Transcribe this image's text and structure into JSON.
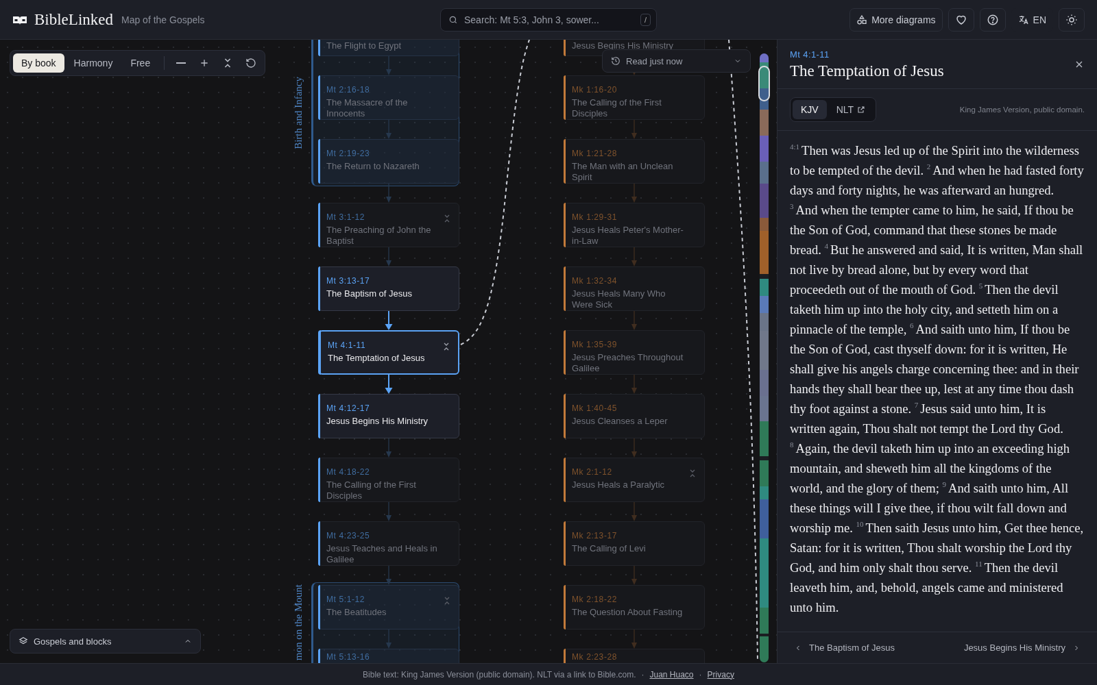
{
  "header": {
    "logo": "BibleLinked",
    "subtitle": "Map of the Gospels",
    "search": {
      "placeholder": "Search: Mt 5:3, John 3, sower...",
      "shortcut": "/"
    },
    "more_button": "More diagrams",
    "language": "EN"
  },
  "toolbar": {
    "modes": [
      {
        "label": "By book",
        "selected": true
      },
      {
        "label": "Harmony",
        "selected": false
      },
      {
        "label": "Free",
        "selected": false
      }
    ]
  },
  "history": {
    "label": "Read just now"
  },
  "legend": {
    "label": "Gospels and blocks"
  },
  "canvas": {
    "columns": [
      {
        "color": "#5ba3f5",
        "items": [
          {
            "kind": "group",
            "label": "Birth and Infancy",
            "nodes": [
              {
                "title": "The Flight to Egypt",
                "dimmed": true,
                "selected": false,
                "collapsible": false
              },
              {
                "ref": "Mt 2:16-18",
                "title": "The Massacre of the Innocents",
                "dimmed": true,
                "selected": false,
                "collapsible": false
              },
              {
                "ref": "Mt 2:19-23",
                "title": "The Return to Nazareth",
                "dimmed": true,
                "selected": false,
                "collapsible": false
              }
            ]
          },
          {
            "kind": "node",
            "ref": "Mt 3:1-12",
            "title": "The Preaching of John the Baptist",
            "dimmed": true,
            "selected": false,
            "collapsible": true
          },
          {
            "kind": "node",
            "ref": "Mt 3:13-17",
            "title": "The Baptism of Jesus",
            "dimmed": false,
            "selected": false,
            "collapsible": false
          },
          {
            "kind": "node",
            "ref": "Mt 4:1-11",
            "title": "The Temptation of Jesus",
            "dimmed": false,
            "selected": true,
            "collapsible": true
          },
          {
            "kind": "node",
            "ref": "Mt 4:12-17",
            "title": "Jesus Begins His Ministry",
            "dimmed": false,
            "selected": false,
            "collapsible": false
          },
          {
            "kind": "node",
            "ref": "Mt 4:18-22",
            "title": "The Calling of the First Disciples",
            "dimmed": true,
            "selected": false,
            "collapsible": false
          },
          {
            "kind": "node",
            "ref": "Mt 4:23-25",
            "title": "Jesus Teaches and Heals in Galilee",
            "dimmed": true,
            "selected": false,
            "collapsible": false
          },
          {
            "kind": "group",
            "label": "mon on the Mount",
            "nodes": [
              {
                "ref": "Mt 5:1-12",
                "title": "The Beatitudes",
                "dimmed": true,
                "selected": false,
                "collapsible": true
              },
              {
                "ref": "Mt 5:13-16",
                "dimmed": true,
                "selected": false,
                "collapsible": false
              }
            ]
          }
        ]
      },
      {
        "color": "#c27a3a",
        "items": [
          {
            "kind": "node",
            "title": "Jesus Begins His Ministry",
            "dimmed": true,
            "selected": false,
            "collapsible": false
          },
          {
            "kind": "node",
            "ref": "Mk 1:16-20",
            "title": "The Calling of the First Disciples",
            "dimmed": true,
            "selected": false,
            "collapsible": false
          },
          {
            "kind": "node",
            "ref": "Mk 1:21-28",
            "title": "The Man with an Unclean Spirit",
            "dimmed": true,
            "selected": false,
            "collapsible": false
          },
          {
            "kind": "node",
            "ref": "Mk 1:29-31",
            "title": "Jesus Heals Peter's Mother-in-Law",
            "dimmed": true,
            "selected": false,
            "collapsible": false
          },
          {
            "kind": "node",
            "ref": "Mk 1:32-34",
            "title": "Jesus Heals Many Who Were Sick",
            "dimmed": true,
            "selected": false,
            "collapsible": false
          },
          {
            "kind": "node",
            "ref": "Mk 1:35-39",
            "title": "Jesus Preaches Throughout Galilee",
            "dimmed": true,
            "selected": false,
            "collapsible": false
          },
          {
            "kind": "node",
            "ref": "Mk 1:40-45",
            "title": "Jesus Cleanses a Leper",
            "dimmed": true,
            "selected": false,
            "collapsible": false
          },
          {
            "kind": "node",
            "ref": "Mk 2:1-12",
            "title": "Jesus Heals a Paralytic",
            "dimmed": true,
            "selected": false,
            "collapsible": true
          },
          {
            "kind": "node",
            "ref": "Mk 2:13-17",
            "title": "The Calling of Levi",
            "dimmed": true,
            "selected": false,
            "collapsible": false
          },
          {
            "kind": "node",
            "ref": "Mk 2:18-22",
            "title": "The Question About Fasting",
            "dimmed": true,
            "selected": false,
            "collapsible": false
          },
          {
            "kind": "node",
            "ref": "Mk 2:23-28",
            "dimmed": true,
            "selected": false,
            "collapsible": false
          }
        ]
      }
    ]
  },
  "reader": {
    "ref": "Mt 4:1-11",
    "title": "The Temptation of Jesus",
    "versions": [
      {
        "label": "KJV",
        "selected": true,
        "external": false
      },
      {
        "label": "NLT",
        "selected": false,
        "external": true
      }
    ],
    "version_note": "King James Version, public domain.",
    "verses": [
      {
        "num": "4:1",
        "text": "Then was Jesus led up of the Spirit into the wilderness to be tempted of the devil."
      },
      {
        "num": "2",
        "text": "And when he had fasted forty days and forty nights, he was afterward an hungred."
      },
      {
        "num": "3",
        "text": "And when the tempter came to him, he said, If thou be the Son of God, command that these stones be made bread."
      },
      {
        "num": "4",
        "text": "But he answered and said, It is written, Man shall not live by bread alone, but by every word that proceedeth out of the mouth of God."
      },
      {
        "num": "5",
        "text": "Then the devil taketh him up into the holy city, and setteth him on a pinnacle of the temple,"
      },
      {
        "num": "6",
        "text": "And saith unto him, If thou be the Son of God, cast thyself down: for it is written, He shall give his angels charge concerning thee: and in their hands they shall bear thee up, lest at any time thou dash thy foot against a stone."
      },
      {
        "num": "7",
        "text": "Jesus said unto him, It is written again, Thou shalt not tempt the Lord thy God."
      },
      {
        "num": "8",
        "text": "Again, the devil taketh him up into an exceeding high mountain, and sheweth him all the kingdoms of the world, and the glory of them;"
      },
      {
        "num": "9",
        "text": "And saith unto him, All these things will I give thee, if thou wilt fall down and worship me."
      },
      {
        "num": "10",
        "text": "Then saith Jesus unto him, Get thee hence, Satan: for it is written, Thou shalt worship the Lord thy God, and him only shalt thou serve."
      },
      {
        "num": "11",
        "text": "Then the devil leaveth him, and, behold, angels came and ministered unto him."
      }
    ],
    "prev": "The Baptism of Jesus",
    "next": "Jesus Begins His Ministry"
  },
  "footer": {
    "text": "Bible text: King James Version (public domain). NLT via a link to Bible.com.",
    "separator": "·",
    "links": [
      "Juan Huaco",
      "Privacy"
    ]
  }
}
